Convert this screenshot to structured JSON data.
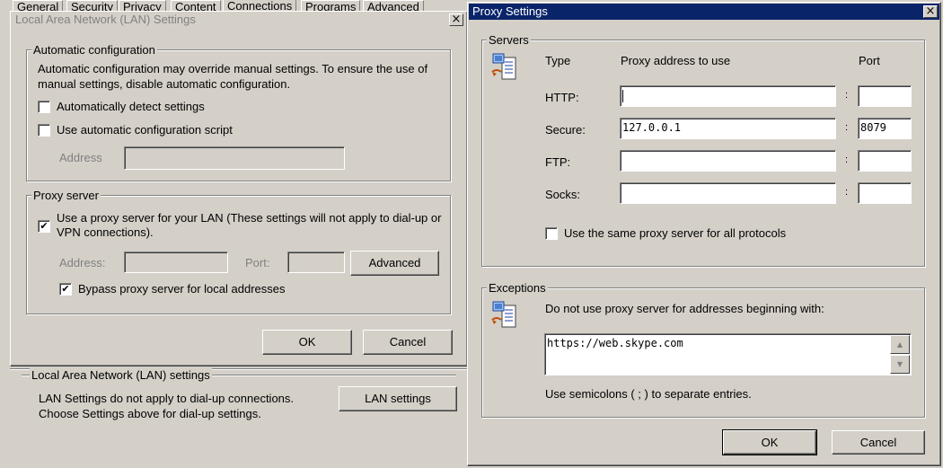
{
  "background_tabs": [
    "General",
    "Security",
    "Privacy",
    "Content",
    "Connections",
    "Programs",
    "Advanced"
  ],
  "lan_dialog": {
    "title": "Local Area Network (LAN) Settings",
    "close_glyph": "×",
    "auto_config": {
      "group_label": "Automatic configuration",
      "description": "Automatic configuration may override manual settings.  To ensure the use of manual settings, disable automatic configuration.",
      "auto_detect_label": "Automatically detect settings",
      "auto_detect_checked": false,
      "use_script_label": "Use automatic configuration script",
      "use_script_checked": false,
      "address_label": "Address",
      "address_value": ""
    },
    "proxy": {
      "group_label": "Proxy server",
      "use_proxy_label": "Use a proxy server for your LAN (These settings will not apply to dial-up or VPN connections).",
      "use_proxy_checked": true,
      "address_label": "Address:",
      "address_value": "",
      "port_label": "Port:",
      "port_value": "",
      "advanced_label": "Advanced",
      "bypass_label": "Bypass proxy server for local addresses",
      "bypass_checked": true
    },
    "ok_label": "OK",
    "cancel_label": "Cancel"
  },
  "lan_section": {
    "label": "Local Area Network (LAN) settings",
    "line1": "LAN Settings do not apply to dial-up connections.",
    "line2": "Choose Settings above for dial-up settings.",
    "button_label": "LAN settings"
  },
  "proxy_dialog": {
    "title": "Proxy Settings",
    "close_glyph": "×",
    "servers": {
      "group_label": "Servers",
      "col_type": "Type",
      "col_address": "Proxy address to use",
      "col_port": "Port",
      "colon": ":",
      "rows": [
        {
          "type": "HTTP:",
          "address": "",
          "port": ""
        },
        {
          "type": "Secure:",
          "address": "127.0.0.1",
          "port": "8079"
        },
        {
          "type": "FTP:",
          "address": "",
          "port": ""
        },
        {
          "type": "Socks:",
          "address": "",
          "port": ""
        }
      ],
      "same_proxy_label": "Use the same proxy server for all protocols",
      "same_proxy_checked": false
    },
    "exceptions": {
      "group_label": "Exceptions",
      "description": "Do not use proxy server for addresses beginning with:",
      "value": "https://web.skype.com",
      "hint": "Use semicolons ( ; ) to separate entries."
    },
    "ok_label": "OK",
    "cancel_label": "Cancel"
  },
  "icons": {
    "network": "network-settings-icon",
    "scroll_up": "scroll-up-arrow-icon",
    "scroll_down": "scroll-down-arrow-icon",
    "check": "checkmark-icon"
  },
  "colors": {
    "face": "#d4d0c8",
    "active_title": "#0a246a",
    "shadow": "#808080"
  }
}
